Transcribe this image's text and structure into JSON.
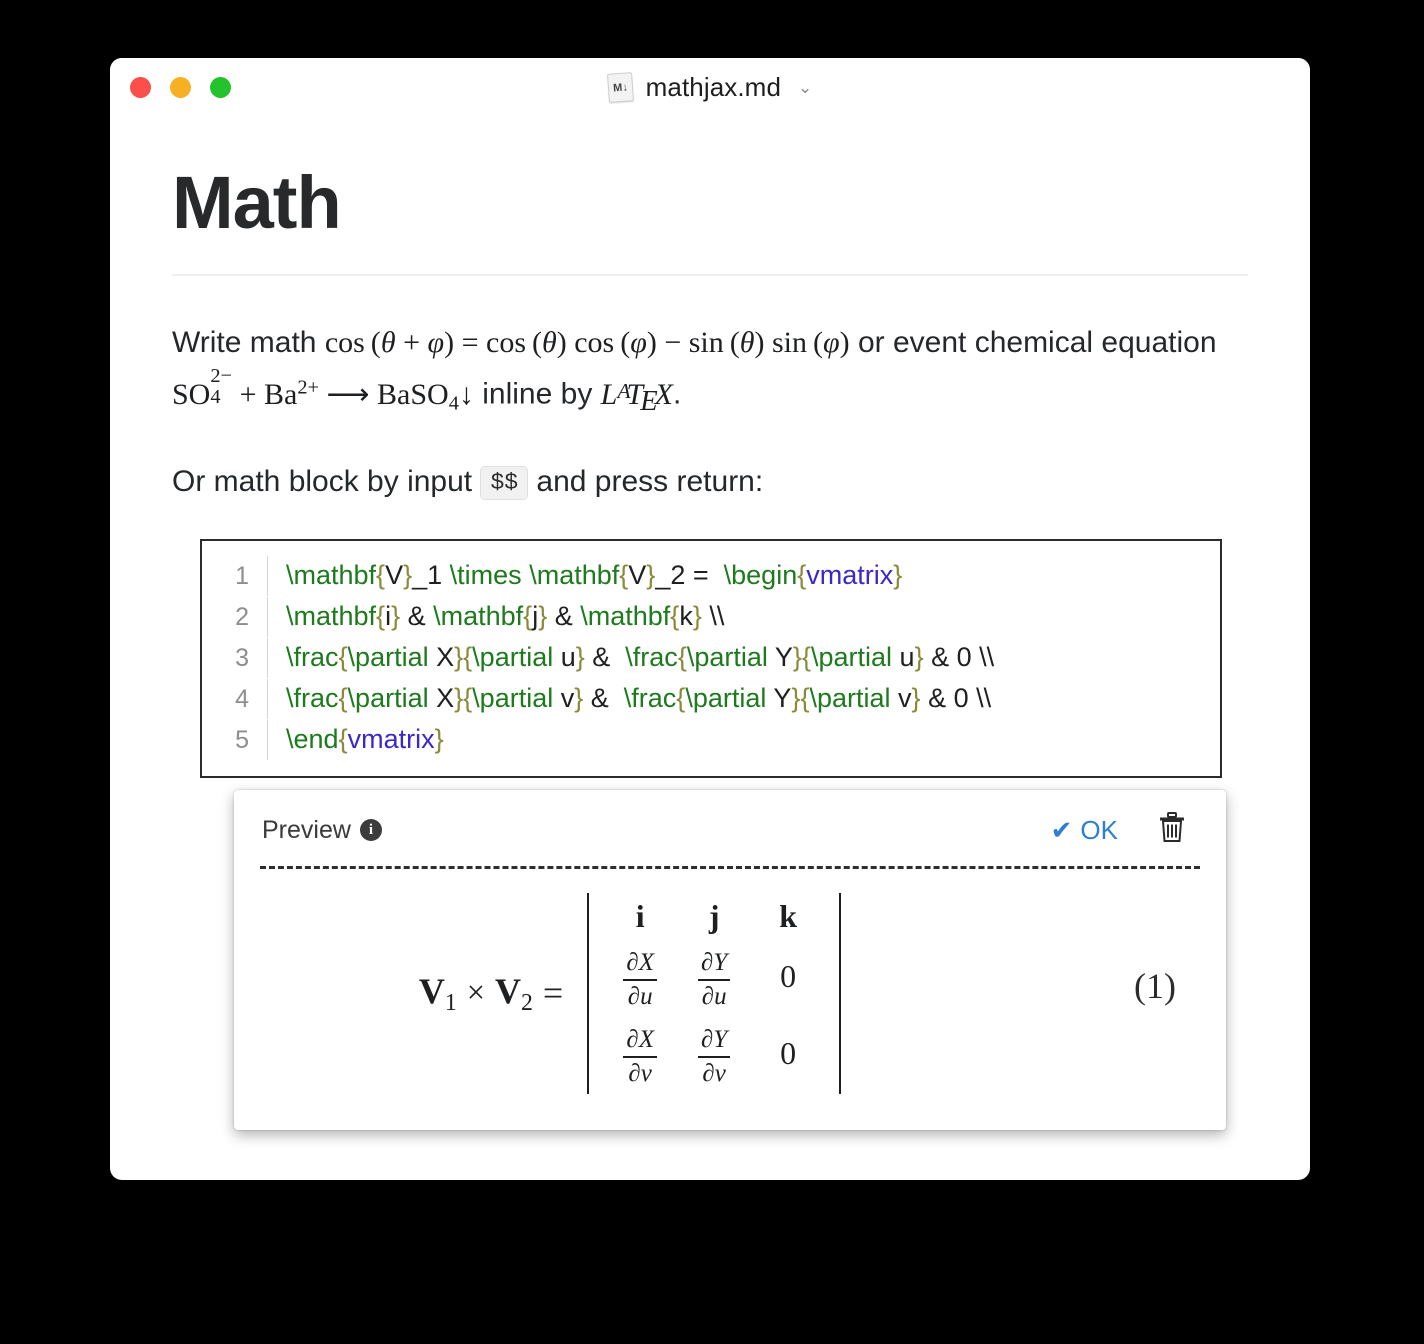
{
  "window": {
    "title": "mathjax.md",
    "file_icon_label": "M↓",
    "chevron": "⌄",
    "traffic_lights": [
      "close",
      "minimize",
      "zoom"
    ]
  },
  "document": {
    "heading": "Math",
    "paragraph1": {
      "text_before": "Write math ",
      "formula_cos": "cos (θ + φ) = cos (θ) cos (φ) − sin (θ) sin (φ)",
      "text_middle": " or event chemical equation ",
      "formula_chem": "SO4^2− + Ba^2+ ⟶ BaSO4↓",
      "text_after": " inline by ",
      "latex_logo": "LaTeX",
      "period": "."
    },
    "paragraph2": {
      "text_before": "Or math block by input ",
      "code": "$$",
      "text_after": " and press return:"
    }
  },
  "code_block": {
    "lines": [
      {
        "number": "1",
        "tokens": [
          {
            "t": "\\mathbf",
            "c": "cmd"
          },
          {
            "t": "{",
            "c": "brace"
          },
          {
            "t": "V",
            "c": "txt"
          },
          {
            "t": "}",
            "c": "brace"
          },
          {
            "t": "_1 ",
            "c": "txt"
          },
          {
            "t": "\\times",
            "c": "cmd"
          },
          {
            "t": " ",
            "c": "txt"
          },
          {
            "t": "\\mathbf",
            "c": "cmd"
          },
          {
            "t": "{",
            "c": "brace"
          },
          {
            "t": "V",
            "c": "txt"
          },
          {
            "t": "}",
            "c": "brace"
          },
          {
            "t": "_2 =  ",
            "c": "txt"
          },
          {
            "t": "\\begin",
            "c": "cmd"
          },
          {
            "t": "{",
            "c": "brace"
          },
          {
            "t": "vmatrix",
            "c": "env"
          },
          {
            "t": "}",
            "c": "brace"
          }
        ]
      },
      {
        "number": "2",
        "tokens": [
          {
            "t": "\\mathbf",
            "c": "cmd"
          },
          {
            "t": "{",
            "c": "brace"
          },
          {
            "t": "i",
            "c": "txt"
          },
          {
            "t": "}",
            "c": "brace"
          },
          {
            "t": " & ",
            "c": "txt"
          },
          {
            "t": "\\mathbf",
            "c": "cmd"
          },
          {
            "t": "{",
            "c": "brace"
          },
          {
            "t": "j",
            "c": "txt"
          },
          {
            "t": "}",
            "c": "brace"
          },
          {
            "t": " & ",
            "c": "txt"
          },
          {
            "t": "\\mathbf",
            "c": "cmd"
          },
          {
            "t": "{",
            "c": "brace"
          },
          {
            "t": "k",
            "c": "txt"
          },
          {
            "t": "}",
            "c": "brace"
          },
          {
            "t": " \\\\",
            "c": "txt"
          }
        ]
      },
      {
        "number": "3",
        "tokens": [
          {
            "t": "\\frac",
            "c": "cmd"
          },
          {
            "t": "{",
            "c": "brace"
          },
          {
            "t": "\\partial",
            "c": "cmd"
          },
          {
            "t": " X",
            "c": "txt"
          },
          {
            "t": "}",
            "c": "brace"
          },
          {
            "t": "{",
            "c": "brace"
          },
          {
            "t": "\\partial",
            "c": "cmd"
          },
          {
            "t": " u",
            "c": "txt"
          },
          {
            "t": "}",
            "c": "brace"
          },
          {
            "t": " &  ",
            "c": "txt"
          },
          {
            "t": "\\frac",
            "c": "cmd"
          },
          {
            "t": "{",
            "c": "brace"
          },
          {
            "t": "\\partial",
            "c": "cmd"
          },
          {
            "t": " Y",
            "c": "txt"
          },
          {
            "t": "}",
            "c": "brace"
          },
          {
            "t": "{",
            "c": "brace"
          },
          {
            "t": "\\partial",
            "c": "cmd"
          },
          {
            "t": " u",
            "c": "txt"
          },
          {
            "t": "}",
            "c": "brace"
          },
          {
            "t": " & 0 \\\\",
            "c": "txt"
          }
        ]
      },
      {
        "number": "4",
        "tokens": [
          {
            "t": "\\frac",
            "c": "cmd"
          },
          {
            "t": "{",
            "c": "brace"
          },
          {
            "t": "\\partial",
            "c": "cmd"
          },
          {
            "t": " X",
            "c": "txt"
          },
          {
            "t": "}",
            "c": "brace"
          },
          {
            "t": "{",
            "c": "brace"
          },
          {
            "t": "\\partial",
            "c": "cmd"
          },
          {
            "t": " v",
            "c": "txt"
          },
          {
            "t": "}",
            "c": "brace"
          },
          {
            "t": " &  ",
            "c": "txt"
          },
          {
            "t": "\\frac",
            "c": "cmd"
          },
          {
            "t": "{",
            "c": "brace"
          },
          {
            "t": "\\partial",
            "c": "cmd"
          },
          {
            "t": " Y",
            "c": "txt"
          },
          {
            "t": "}",
            "c": "brace"
          },
          {
            "t": "{",
            "c": "brace"
          },
          {
            "t": "\\partial",
            "c": "cmd"
          },
          {
            "t": " v",
            "c": "txt"
          },
          {
            "t": "}",
            "c": "brace"
          },
          {
            "t": " & 0 \\\\",
            "c": "txt"
          }
        ]
      },
      {
        "number": "5",
        "tokens": [
          {
            "t": "\\end",
            "c": "cmd"
          },
          {
            "t": "{",
            "c": "brace"
          },
          {
            "t": "vmatrix",
            "c": "env"
          },
          {
            "t": "}",
            "c": "brace"
          }
        ]
      }
    ]
  },
  "preview": {
    "label": "Preview",
    "info_glyph": "i",
    "ok_label": "OK",
    "ok_check": "✔",
    "equation_number": "(1)",
    "rendered": {
      "lhs_v1": "V",
      "lhs_v1_sub": "1",
      "times": "×",
      "lhs_v2": "V",
      "lhs_v2_sub": "2",
      "equals": "=",
      "matrix": [
        [
          "i",
          "j",
          "k"
        ],
        [
          "∂X/∂u",
          "∂Y/∂u",
          "0"
        ],
        [
          "∂X/∂v",
          "∂Y/∂v",
          "0"
        ]
      ]
    }
  },
  "colors": {
    "accent_blue": "#2f7fd1",
    "code_command": "#1d7a1d",
    "code_brace": "#8a8a3a",
    "code_env": "#3b28cc",
    "light_red": "#fc4e4a",
    "light_yellow": "#f6b024",
    "light_green": "#24c22d"
  }
}
